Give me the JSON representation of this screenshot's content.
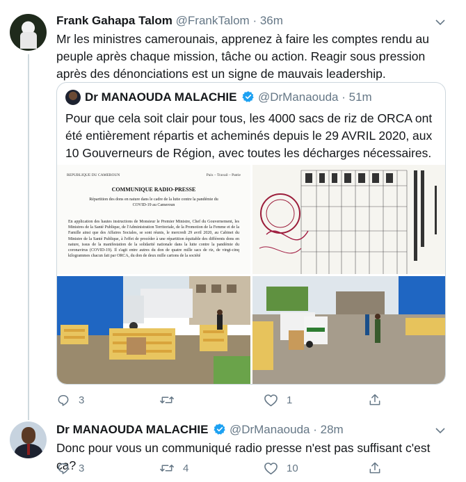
{
  "tweet1": {
    "name": "Frank Gahapa Talom",
    "handle": "@FrankTalom",
    "separator": "·",
    "time": "36m",
    "text": "Mr les ministres camerounais, apprenez à faire les comptes rendu au peuple après chaque mission, tâche ou action. Reagir sous pression après des dénonciations est un signe de mauvais leadership.",
    "quote": {
      "name": "Dr MANAOUDA MALACHIE",
      "handle": "@DrManaouda",
      "separator": "·",
      "time": "51m",
      "text": "Pour que cela soit clair pour tous, les 4000 sacs de riz de ORCA ont été entièrement répartis et acheminés depuis le 29 AVRIL 2020, aux 10 Gouverneurs de Région, avec toutes les décharges nécessaires.",
      "document": {
        "left_header": "REPUBLIQUE DU CAMEROUN",
        "right_header": "Paix – Travail – Patrie",
        "title": "COMMUNIQUE RADIO-PRESSE",
        "subtitle": "Répartition des dons en nature dans le cadre de la lutte contre la pandémie du COVID-19 au Cameroun",
        "body": "En application des hautes instructions de Monsieur le Premier Ministre, Chef du Gouvernement, les Ministres de la Santé Publique, de l'Administration Territoriale, de la Promotion de la Femme et de la Famille ainsi que des Affaires Sociales, se sont réunis, le mercredi 29 avril 2020, au Cabinet du Ministre de la Santé Publique, à l'effet de procéder à une répartition équitable des différents dons en nature, issus de la manifestation de la solidarité nationale dans la lutte contre la pandémie du coronavirus (COVID-19). Il s'agit entre autres du don de quatre mille sacs de riz, de vingt-cinq kilogrammes chacun fait par ORCA, du don de deux mille cartons de la société"
      }
    },
    "actions": {
      "replies": "3",
      "likes": "1"
    }
  },
  "tweet2": {
    "name": "Dr MANAOUDA MALACHIE",
    "handle": "@DrManaouda",
    "separator": "·",
    "time": "28m",
    "text": "Donc pour vous un communiqué radio presse n'est pas suffisant c'est ca?",
    "actions": {
      "replies": "3",
      "retweets": "4",
      "likes": "10"
    }
  },
  "icons": [
    "reply-icon",
    "retweet-icon",
    "like-icon",
    "share-icon",
    "verified-badge-icon",
    "chevron-down-icon"
  ],
  "colors": {
    "text": "#14171a",
    "muted": "#657786",
    "verified": "#1da1f2",
    "border": "#ccd6dd"
  }
}
